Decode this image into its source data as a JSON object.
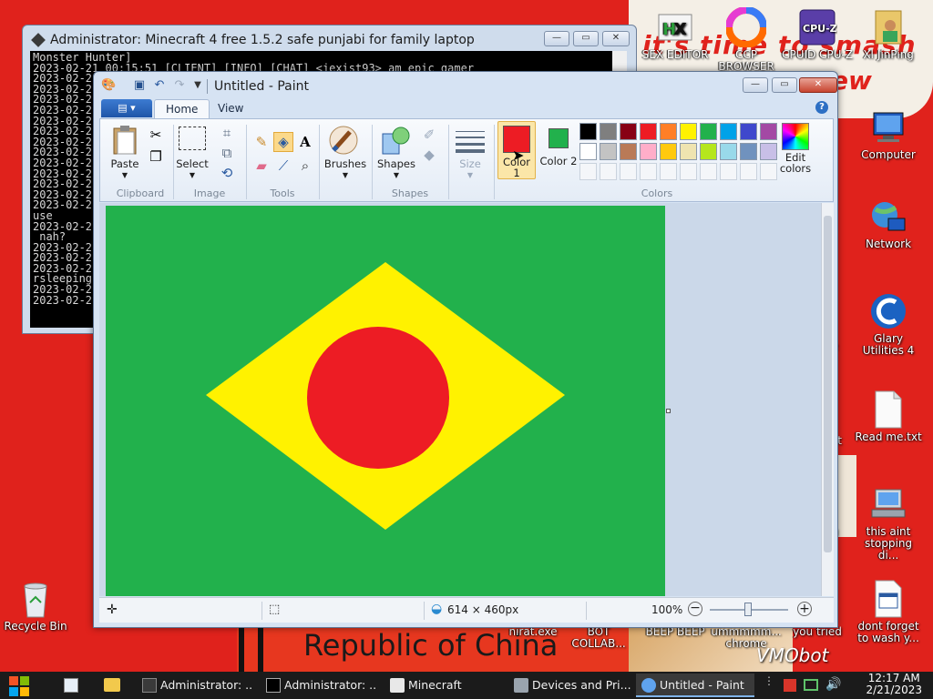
{
  "desktop": {
    "banner_lines": [
      "it's time to smash",
      "ew"
    ],
    "bottom_banner": "Republic of China",
    "icons": [
      {
        "id": "hxd",
        "label": "SEX EDITOR",
        "name": "hex-editor-icon"
      },
      {
        "id": "ccp",
        "label": "CCP BROWSER",
        "name": "ccp-browser-icon"
      },
      {
        "id": "cpuz",
        "label": "CPUID CPU-Z",
        "name": "cpuz-icon"
      },
      {
        "id": "kunping",
        "label": "XI JinPing",
        "name": "user-folder-icon"
      },
      {
        "id": "computer",
        "label": "Computer",
        "name": "computer-icon"
      },
      {
        "id": "network",
        "label": "Network",
        "name": "network-icon"
      },
      {
        "id": "glary",
        "label": "Glary Utilities 4",
        "name": "glary-utilities-icon"
      },
      {
        "id": "readme",
        "label": "Read me.txt",
        "name": "text-file-icon"
      },
      {
        "id": "thisaint",
        "label": "this aint stopping di...",
        "name": "network-drive-icon"
      },
      {
        "id": "dontforget",
        "label": "dont forget to wash y...",
        "name": "calendar-file-icon"
      },
      {
        "id": "recycle",
        "label": "Recycle Bin",
        "name": "recycle-bin-icon"
      },
      {
        "id": "nirat",
        "label": "nirat.exe",
        "name": "nirat-exe-icon"
      },
      {
        "id": "bot",
        "label": "BOT COLLAB...",
        "name": "bot-collab-icon"
      },
      {
        "id": "beep",
        "label": "BEEP BEEP",
        "name": "beep-beep-icon"
      },
      {
        "id": "ummm",
        "label": "ummmmm... chrome",
        "name": "chrome-shortcut-icon"
      },
      {
        "id": "youtried",
        "label": "you tried",
        "name": "you-tried-icon"
      }
    ],
    "partial_labels": {
      "e1": "e",
      "it": "it",
      "u": "u"
    },
    "watermark": "VMObot"
  },
  "console": {
    "title": "Administrator:  Minecraft 4 free 1.5.2 safe punjabi for family laptop",
    "lines": [
      "Monster Hunter]",
      "2023-02-21 00:15:51 [CLIENT] [INFO] [CHAT] <jexist93> am epic gamer",
      "2023-02-2",
      "2023-02-2",
      "2023-02-2",
      "2023-02-2",
      "2023-02-2",
      "2023-02-2",
      "2023-02-2",
      "2023-02-2",
      "2023-02-2",
      "2023-02-2",
      "2023-02-2",
      "2023-02-2",
      "2023-02-2",
      "use",
      "2023-02-2",
      " nah?",
      "2023-02-2",
      "2023-02-2",
      "2023-02-2",
      "rsleeping",
      "2023-02-2",
      "2023-02-2"
    ]
  },
  "paint": {
    "title": "Untitled - Paint",
    "tabs": {
      "home": "Home",
      "view": "View"
    },
    "clipboard": {
      "paste": "Paste",
      "group": "Clipboard"
    },
    "image": {
      "select": "Select",
      "group": "Image"
    },
    "tools": {
      "group": "Tools"
    },
    "brushes": "Brushes",
    "shapes": {
      "label": "Shapes",
      "group": "Shapes"
    },
    "size": "Size",
    "color1": "Color 1",
    "color2": "Color 2",
    "edit_colors": "Edit colors",
    "colors_group": "Colors",
    "color1_value": "#ed1c24",
    "color2_value": "#22b14c",
    "palette_row1": [
      "#000000",
      "#7f7f7f",
      "#880015",
      "#ed1c24",
      "#ff7f27",
      "#fff200",
      "#22b14c",
      "#00a2e8",
      "#3f48cc",
      "#a349a4"
    ],
    "palette_row2": [
      "#ffffff",
      "#c3c3c3",
      "#b97a57",
      "#ffaec9",
      "#ffc90e",
      "#efe4b0",
      "#b5e61d",
      "#99d9ea",
      "#7092be",
      "#c8bfe7"
    ],
    "canvas": {
      "background": "#22b14c",
      "diamond": "#fff200",
      "circle": "#ed1c24"
    },
    "status": {
      "dimensions": "614 × 460px",
      "zoom": "100%"
    }
  },
  "taskbar": {
    "items": [
      {
        "label": "Administrator: ...",
        "name": "taskbar-console-minecraft"
      },
      {
        "label": "Administrator: ...",
        "name": "taskbar-cmd"
      },
      {
        "label": "Minecraft",
        "name": "taskbar-minecraft"
      },
      {
        "label": "Devices and Pri...",
        "name": "taskbar-devices-printers"
      },
      {
        "label": "Untitled - Paint",
        "name": "taskbar-paint"
      }
    ],
    "time": "12:17 AM",
    "date": "2/21/2023"
  }
}
